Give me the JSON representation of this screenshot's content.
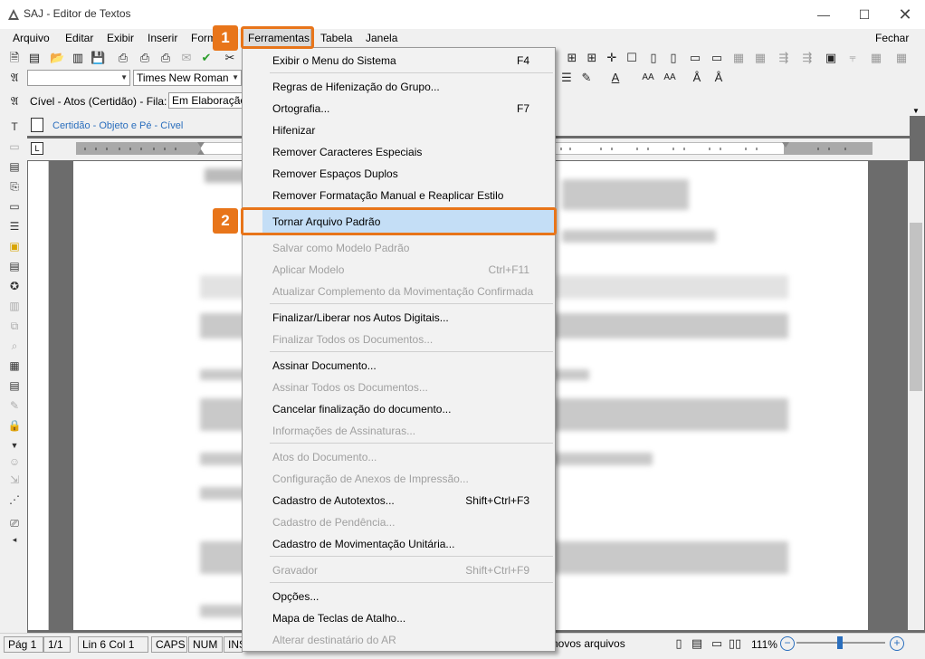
{
  "window": {
    "title": "SAJ - Editor de Textos"
  },
  "menubar": {
    "items": [
      {
        "label": "Arquivo",
        "underline": "A"
      },
      {
        "label": "Editar",
        "underline": "E"
      },
      {
        "label": "Exibir",
        "underline": "x"
      },
      {
        "label": "Inserir",
        "underline": "I"
      },
      {
        "label": "Formatar",
        "underline": "F"
      },
      {
        "label": "Ferramentas",
        "underline": "m"
      },
      {
        "label": "Tabela",
        "underline": "a"
      },
      {
        "label": "Janela",
        "underline": "J"
      }
    ],
    "close_label": "Fechar"
  },
  "toolbar": {
    "font_size_value": "",
    "font_name_value": "Times New Roman",
    "cartorio_label": "Cível - Atos (Certidão) - Fila:",
    "fila_value": "Em Elaboração",
    "document_tab": "Certidão - Objeto e Pé - Cível"
  },
  "dropdown": {
    "items": [
      {
        "label": "Exibir o Menu do Sistema",
        "shortcut": "F4",
        "disabled": false
      },
      {
        "label": "Regras de Hifenização do Grupo...",
        "shortcut": "",
        "disabled": false
      },
      {
        "label": "Ortografia...",
        "shortcut": "F7",
        "disabled": false
      },
      {
        "label": "Hifenizar",
        "shortcut": "",
        "disabled": false
      },
      {
        "label": "Remover Caracteres Especiais",
        "shortcut": "",
        "disabled": false
      },
      {
        "label": "Remover Espaços Duplos",
        "shortcut": "",
        "disabled": false
      },
      {
        "label": "Remover Formatação Manual e Reaplicar Estilo",
        "shortcut": "",
        "disabled": false
      },
      {
        "label": "Tornar Arquivo Padrão",
        "shortcut": "",
        "disabled": false,
        "highlighted": true
      },
      {
        "label": "Salvar como Modelo Padrão",
        "shortcut": "",
        "disabled": true
      },
      {
        "label": "Aplicar Modelo",
        "shortcut": "Ctrl+F11",
        "disabled": true
      },
      {
        "label": "Atualizar Complemento da Movimentação Confirmada",
        "shortcut": "",
        "disabled": true
      },
      {
        "label": "Finalizar/Liberar nos Autos Digitais...",
        "shortcut": "",
        "disabled": false
      },
      {
        "label": "Finalizar Todos os Documentos...",
        "shortcut": "",
        "disabled": true
      },
      {
        "label": "Assinar Documento...",
        "shortcut": "",
        "disabled": false
      },
      {
        "label": "Assinar Todos os Documentos...",
        "shortcut": "",
        "disabled": true
      },
      {
        "label": "Cancelar finalização do documento...",
        "shortcut": "",
        "disabled": false
      },
      {
        "label": "Informações de Assinaturas...",
        "shortcut": "",
        "disabled": true
      },
      {
        "label": "Atos do Documento...",
        "shortcut": "",
        "disabled": true
      },
      {
        "label": "Configuração de Anexos de Impressão...",
        "shortcut": "",
        "disabled": true
      },
      {
        "label": "Cadastro de Autotextos...",
        "shortcut": "Shift+Ctrl+F3",
        "disabled": false
      },
      {
        "label": "Cadastro de Pendência...",
        "shortcut": "",
        "disabled": true
      },
      {
        "label": "Cadastro de Movimentação Unitária...",
        "shortcut": "",
        "disabled": false
      },
      {
        "label": "Gravador",
        "shortcut": "Shift+Ctrl+F9",
        "disabled": true
      },
      {
        "label": "Opções...",
        "shortcut": "",
        "disabled": false
      },
      {
        "label": "Mapa de Teclas de Atalho...",
        "shortcut": "",
        "disabled": false
      },
      {
        "label": "Alterar destinatário do AR",
        "shortcut": "",
        "disabled": true
      }
    ]
  },
  "callouts": {
    "one": "1",
    "two": "2"
  },
  "statusbar": {
    "page": "Pág 1",
    "pages": "1/1",
    "line_col": "Lin 6  Col 1",
    "caps": "CAPS",
    "num": "NUM",
    "ins": "INS",
    "novos": "novos arquivos",
    "zoom": "111%"
  },
  "colors": {
    "accent": "#e8751a",
    "highlight": "#c4def6"
  }
}
